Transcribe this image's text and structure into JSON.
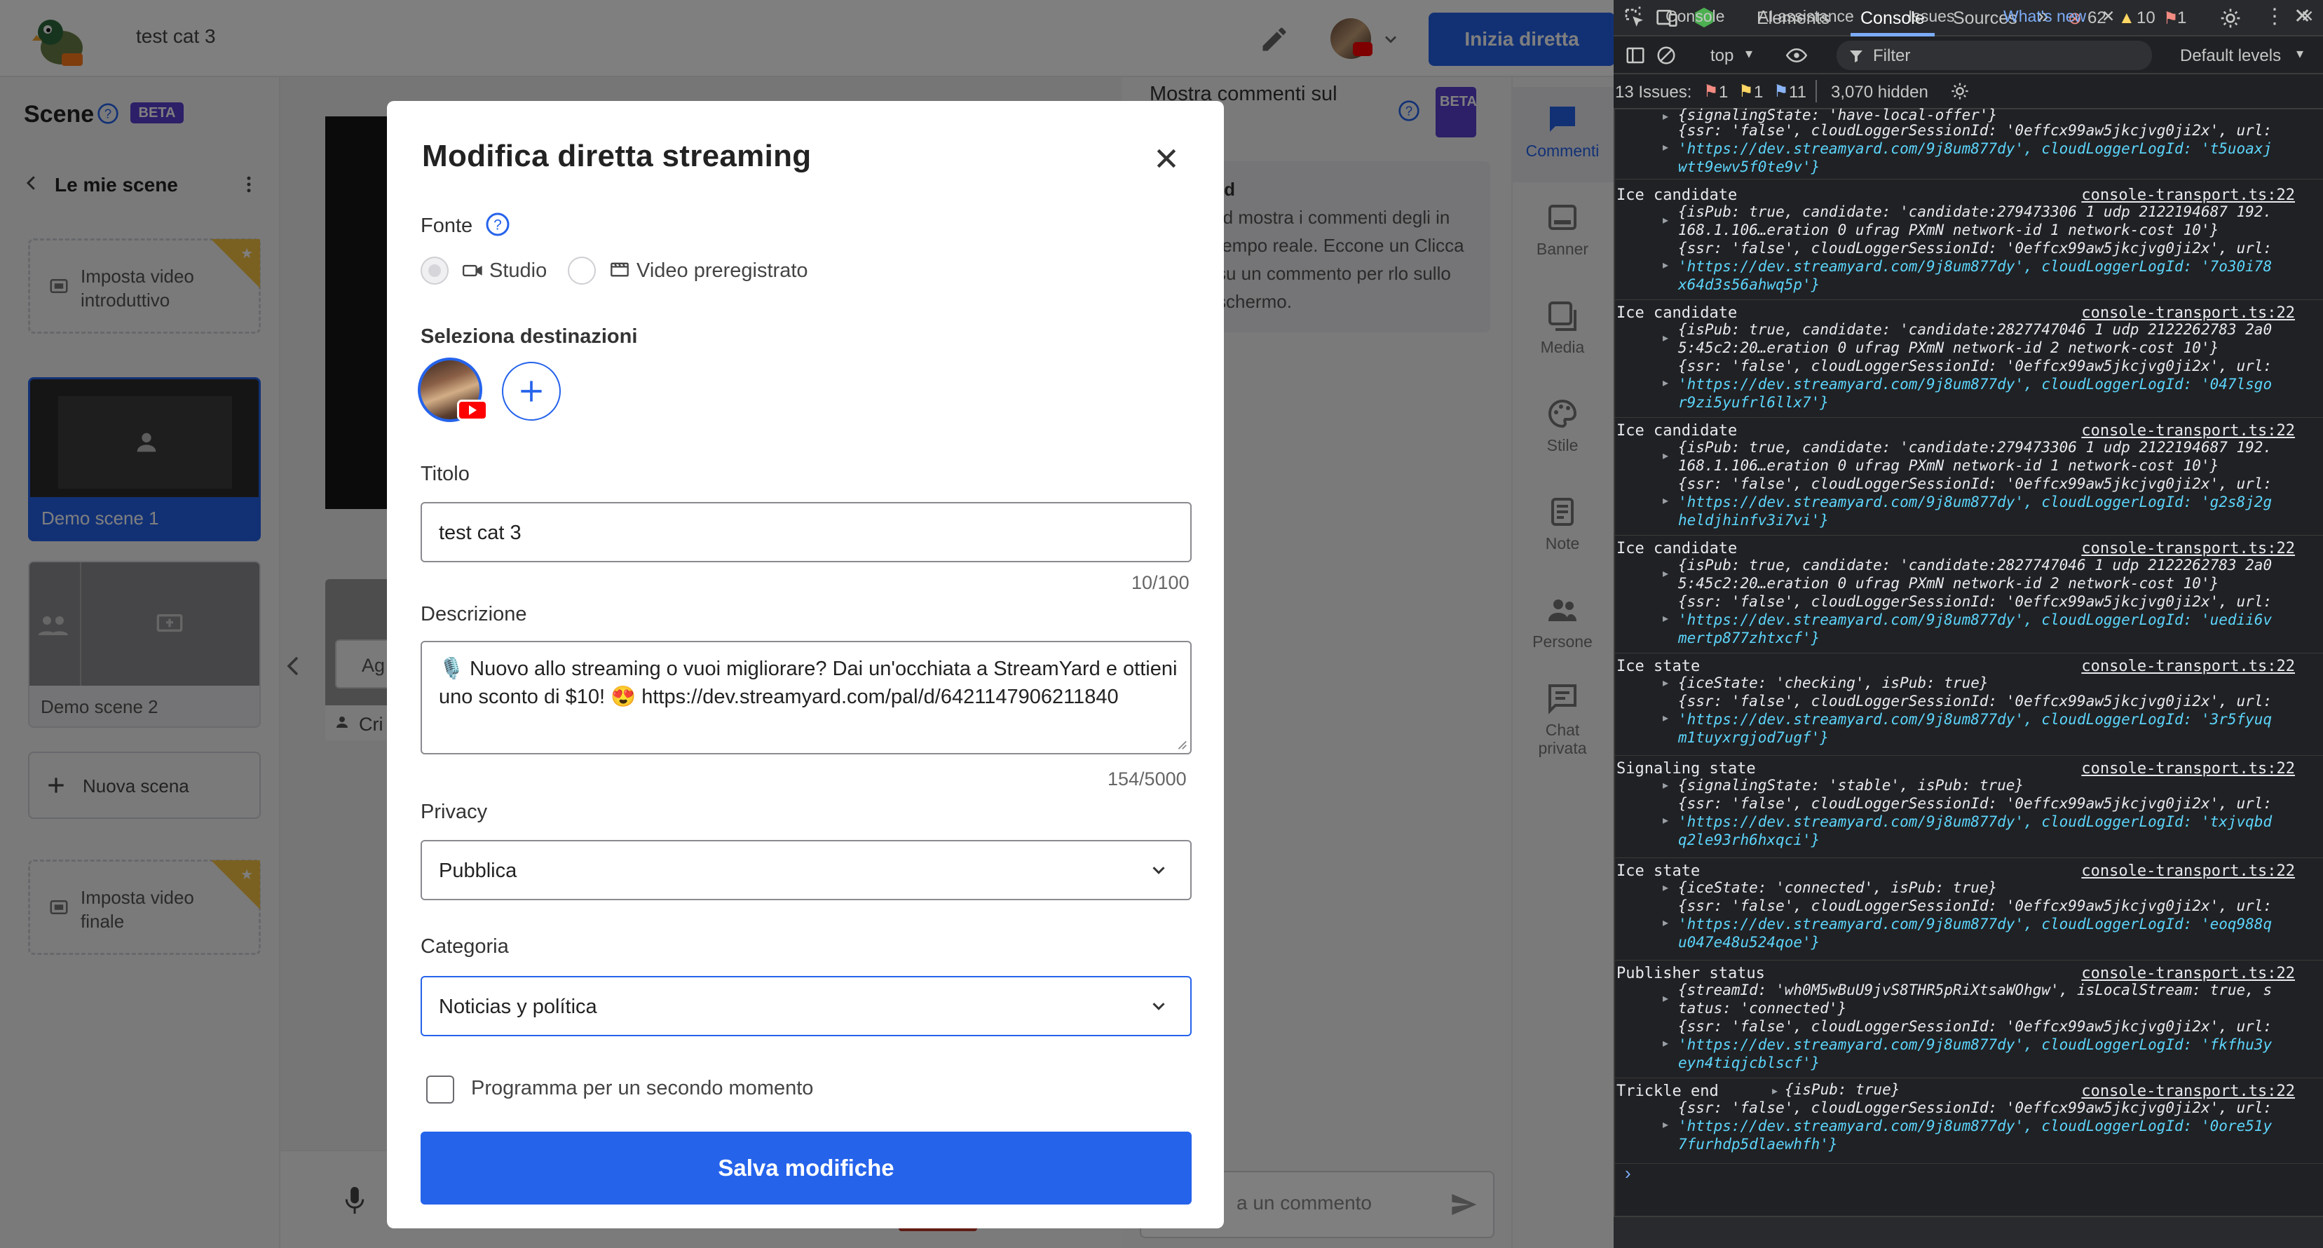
{
  "app": {
    "broadcast_title": "test cat 3",
    "go_live_label": "Inizia diretta",
    "scenes": {
      "title": "Scene",
      "beta": "BETA",
      "back_label": "Le mie scene",
      "intro_video": "Imposta video introduttivo",
      "scenes": [
        {
          "label": "Demo scene 1",
          "active": true
        },
        {
          "label": "Demo scene 2",
          "active": false
        }
      ],
      "new_scene": "Nuova scena",
      "outro_video": "Imposta video finale"
    },
    "stage": {
      "partial_button": "Ag",
      "partial_cri": "Cri"
    },
    "comments": {
      "title": "Mostra commenti sul",
      "beta": "BETA",
      "info_heading": "rd",
      "info_text": "rd mostra i commenti degli in tempo reale. Eccone un Clicca su un commento per rlo sullo schermo.",
      "input_placeholder": "a un commento"
    },
    "rail": [
      {
        "label": "Commenti",
        "icon": "comment-icon"
      },
      {
        "label": "Banner",
        "icon": "banner-icon"
      },
      {
        "label": "Media",
        "icon": "media-icon"
      },
      {
        "label": "Stile",
        "icon": "palette-icon"
      },
      {
        "label": "Note",
        "icon": "notes-icon"
      },
      {
        "label": "Persone",
        "icon": "people-icon"
      },
      {
        "label": "Chat privata",
        "icon": "private-chat-icon"
      }
    ]
  },
  "modal": {
    "title": "Modifica diretta streaming",
    "fonte_label": "Fonte",
    "source_options": [
      "Studio",
      "Video preregistrato"
    ],
    "destinations_label": "Seleziona destinazioni",
    "title_label": "Titolo",
    "title_value": "test cat 3",
    "title_counter": "10/100",
    "description_label": "Descrizione",
    "description_value": "🎙️ Nuovo allo streaming o vuoi migliorare? Dai un'occhiata a StreamYard e ottieni uno sconto di $10! 😍 https://dev.streamyard.com/pal/d/6421147906211840",
    "description_counter": "154/5000",
    "privacy_label": "Privacy",
    "privacy_value": "Pubblica",
    "category_label": "Categoria",
    "category_value": "Noticias y política",
    "schedule_label": "Programma per un secondo momento",
    "save_label": "Salva modifiche"
  },
  "devtools": {
    "tabs": [
      "Elements",
      "Console",
      "Sources"
    ],
    "error_count": "62",
    "warning_count": "10",
    "issue_badge": "1",
    "context": "top",
    "filter_placeholder": "Filter",
    "levels": "Default levels",
    "issues_label": "13 Issues:",
    "issues_err": "1",
    "issues_warn": "1",
    "issues_info": "11",
    "hidden": "3,070 hidden",
    "logs": [
      {
        "title": "",
        "source": "",
        "lines": [
          "{signalingState: 'have-local-offer'}",
          "{ssr: 'false', cloudLoggerSessionId: '0effcx99aw5jkcjvg0ji2x', url:",
          "'https://dev.streamyard.com/9j8um877dy', cloudLoggerLogId: 't5uoaxj",
          "wtt9ewv5f0te9v'}"
        ]
      },
      {
        "title": "Ice candidate",
        "source": "console-transport.ts:22",
        "lines": [
          "{isPub: true, candidate: 'candidate:279473306 1 udp 2122194687 192.",
          "168.1.106…eration 0 ufrag PXmN network-id 1 network-cost 10'}",
          "{ssr: 'false', cloudLoggerSessionId: '0effcx99aw5jkcjvg0ji2x', url:",
          "'https://dev.streamyard.com/9j8um877dy', cloudLoggerLogId: '7o30i78",
          "x64d3s56ahwq5p'}"
        ]
      },
      {
        "title": "Ice candidate",
        "source": "console-transport.ts:22",
        "lines": [
          "{isPub: true, candidate: 'candidate:2827747046 1 udp 2122262783 2a0",
          "5:45c2:20…eration 0 ufrag PXmN network-id 2 network-cost 10'}",
          "{ssr: 'false', cloudLoggerSessionId: '0effcx99aw5jkcjvg0ji2x', url:",
          "'https://dev.streamyard.com/9j8um877dy', cloudLoggerLogId: '047lsgo",
          "r9zi5yufrl6llx7'}"
        ]
      },
      {
        "title": "Ice candidate",
        "source": "console-transport.ts:22",
        "lines": [
          "{isPub: true, candidate: 'candidate:279473306 1 udp 2122194687 192.",
          "168.1.106…eration 0 ufrag PXmN network-id 1 network-cost 10'}",
          "{ssr: 'false', cloudLoggerSessionId: '0effcx99aw5jkcjvg0ji2x', url:",
          "'https://dev.streamyard.com/9j8um877dy', cloudLoggerLogId: 'g2s8j2g",
          "heldjhinfv3i7vi'}"
        ]
      },
      {
        "title": "Ice candidate",
        "source": "console-transport.ts:22",
        "lines": [
          "{isPub: true, candidate: 'candidate:2827747046 1 udp 2122262783 2a0",
          "5:45c2:20…eration 0 ufrag PXmN network-id 2 network-cost 10'}",
          "{ssr: 'false', cloudLoggerSessionId: '0effcx99aw5jkcjvg0ji2x', url:",
          "'https://dev.streamyard.com/9j8um877dy', cloudLoggerLogId: 'uedii6v",
          "mertp877zhtxcf'}"
        ]
      },
      {
        "title": "Ice state",
        "source": "console-transport.ts:22",
        "lines": [
          "{iceState: 'checking', isPub: true}",
          "{ssr: 'false', cloudLoggerSessionId: '0effcx99aw5jkcjvg0ji2x', url:",
          "'https://dev.streamyard.com/9j8um877dy', cloudLoggerLogId: '3r5fyuq",
          "m1tuyxrgjod7ugf'}"
        ]
      },
      {
        "title": "Signaling state",
        "source": "console-transport.ts:22",
        "lines": [
          "{signalingState: 'stable', isPub: true}",
          "{ssr: 'false', cloudLoggerSessionId: '0effcx99aw5jkcjvg0ji2x', url:",
          "'https://dev.streamyard.com/9j8um877dy', cloudLoggerLogId: 'txjvqbd",
          "q2le93rh6hxqci'}"
        ]
      },
      {
        "title": "Ice state",
        "source": "console-transport.ts:22",
        "lines": [
          "{iceState: 'connected', isPub: true}",
          "{ssr: 'false', cloudLoggerSessionId: '0effcx99aw5jkcjvg0ji2x', url:",
          "'https://dev.streamyard.com/9j8um877dy', cloudLoggerLogId: 'eoq988q",
          "u047e48u524qoe'}"
        ]
      },
      {
        "title": "Publisher status",
        "source": "console-transport.ts:22",
        "lines": [
          "{streamId: 'wh0M5wBuU9jvS8THR5pRiXtsaWOhgw', isLocalStream: true, s",
          "tatus: 'connected'}",
          "{ssr: 'false', cloudLoggerSessionId: '0effcx99aw5jkcjvg0ji2x', url:",
          "'https://dev.streamyard.com/9j8um877dy', cloudLoggerLogId: 'fkfhu3y",
          "eyn4tiqjcblscf'}"
        ]
      },
      {
        "title": "Trickle end",
        "source": "console-transport.ts:22",
        "lines": [
          "{isPub: true}",
          "{ssr: 'false', cloudLoggerSessionId: '0effcx99aw5jkcjvg0ji2x', url:",
          "'https://dev.streamyard.com/9j8um877dy', cloudLoggerLogId: '0ore51y",
          "7furhdp5dlaewhfh'}"
        ]
      }
    ],
    "bottom_tabs": [
      "Console",
      "AI assistance",
      "Issues",
      "What's new"
    ]
  }
}
